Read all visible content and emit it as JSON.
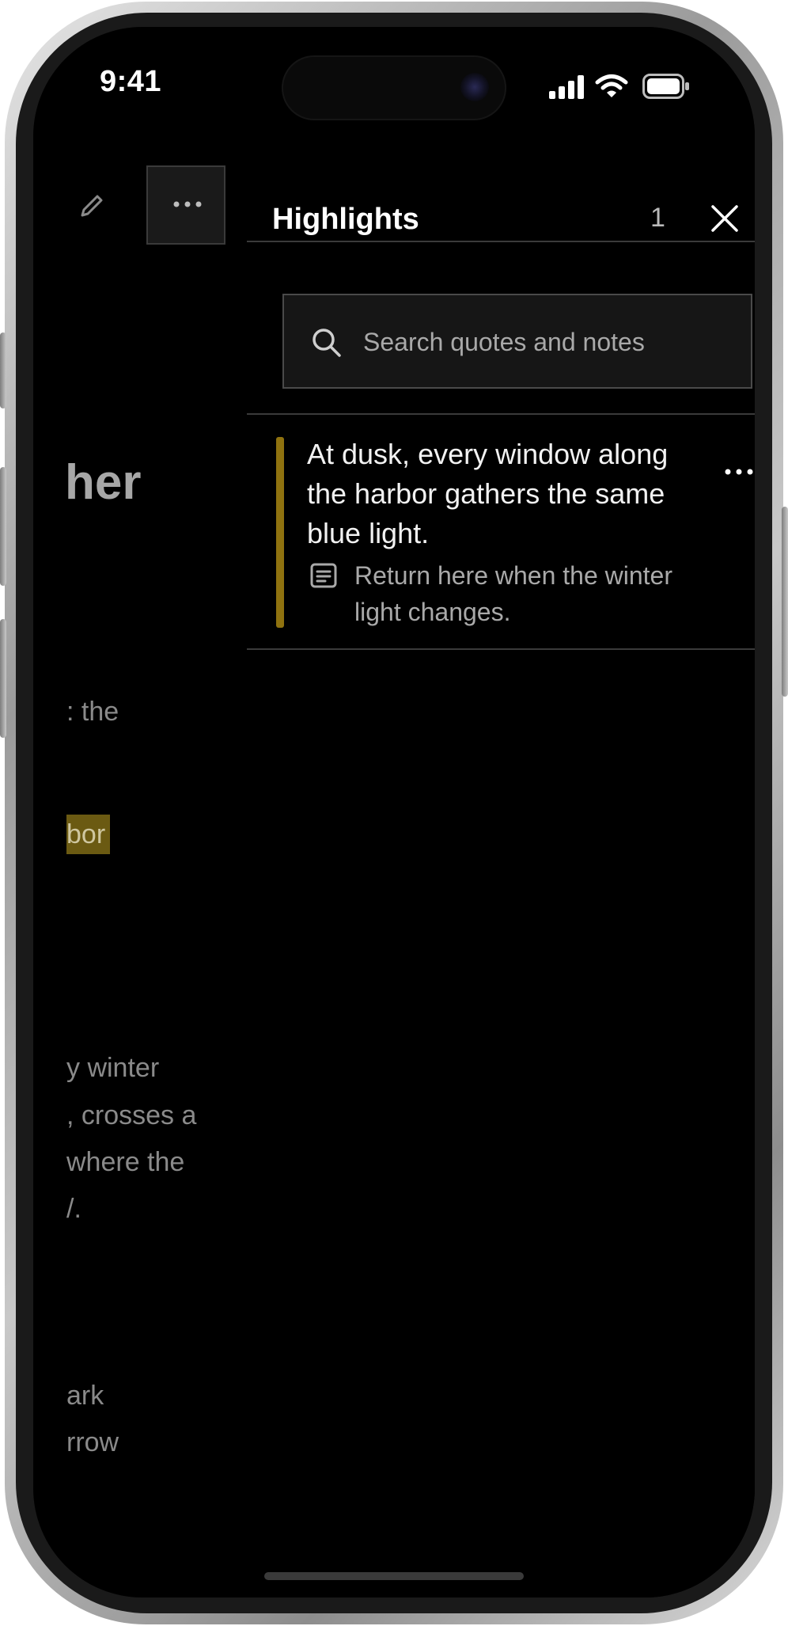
{
  "status_bar": {
    "time": "9:41",
    "signal_icon": "cellular-signal-icon",
    "wifi_icon": "wifi-icon",
    "battery_icon": "battery-icon"
  },
  "article": {
    "edit_icon": "pencil-icon",
    "more_icon": "ellipsis-icon",
    "title_fragment": "her",
    "lines": [
      ": the",
      "y winter",
      ", crosses a",
      "where the",
      "/.",
      "ark",
      "rrow"
    ],
    "highlight_fragment": "bor",
    "highlight_color": "#6b5a12"
  },
  "panel": {
    "title": "Highlights",
    "count": "1",
    "close_icon": "close-icon",
    "search": {
      "placeholder": "Search quotes and notes",
      "icon": "search-icon"
    },
    "highlights": [
      {
        "quote": "At dusk, every window along the harbor gathers the same blue light.",
        "note": "Return here when the winter light changes.",
        "note_icon": "note-icon",
        "more_icon": "ellipsis-icon",
        "color": "#8f720f"
      }
    ]
  }
}
